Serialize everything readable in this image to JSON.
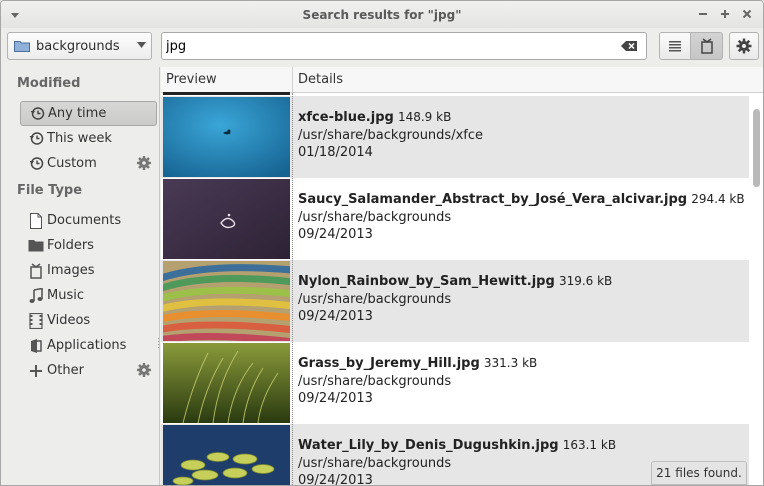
{
  "window": {
    "title": "Search results for \"jpg\""
  },
  "toolbar": {
    "location_label": "backgrounds",
    "search_value": "jpg"
  },
  "sidebar": {
    "modified_title": "Modified",
    "modified_items": [
      {
        "label": "Any time",
        "selected": true
      },
      {
        "label": "This week"
      },
      {
        "label": "Custom"
      }
    ],
    "filetype_title": "File Type",
    "filetype_items": [
      {
        "label": "Documents",
        "icon": "document-icon"
      },
      {
        "label": "Folders",
        "icon": "folder-icon"
      },
      {
        "label": "Images",
        "icon": "image-icon"
      },
      {
        "label": "Music",
        "icon": "music-icon"
      },
      {
        "label": "Videos",
        "icon": "video-icon"
      },
      {
        "label": "Applications",
        "icon": "application-icon"
      },
      {
        "label": "Other",
        "icon": "plus-icon"
      }
    ]
  },
  "results": {
    "columns": [
      "Preview",
      "Details"
    ],
    "rows": [
      {
        "name": "xfce-blue.jpg",
        "size": "148.9 kB",
        "path": "/usr/share/backgrounds/xfce",
        "date": "01/18/2014"
      },
      {
        "name": "Saucy_Salamander_Abstract_by_José_Vera_alcivar.jpg",
        "size": "294.4 kB",
        "path": "/usr/share/backgrounds",
        "date": "09/24/2013"
      },
      {
        "name": "Nylon_Rainbow_by_Sam_Hewitt.jpg",
        "size": "319.6 kB",
        "path": "/usr/share/backgrounds",
        "date": "09/24/2013"
      },
      {
        "name": "Grass_by_Jeremy_Hill.jpg",
        "size": "331.3 kB",
        "path": "/usr/share/backgrounds",
        "date": "09/24/2013"
      },
      {
        "name": "Water_Lily_by_Denis_Dugushkin.jpg",
        "size": "163.1 kB",
        "path": "/usr/share/backgrounds",
        "date": "09/24/2013"
      }
    ]
  },
  "status": {
    "text": "21 files found."
  }
}
